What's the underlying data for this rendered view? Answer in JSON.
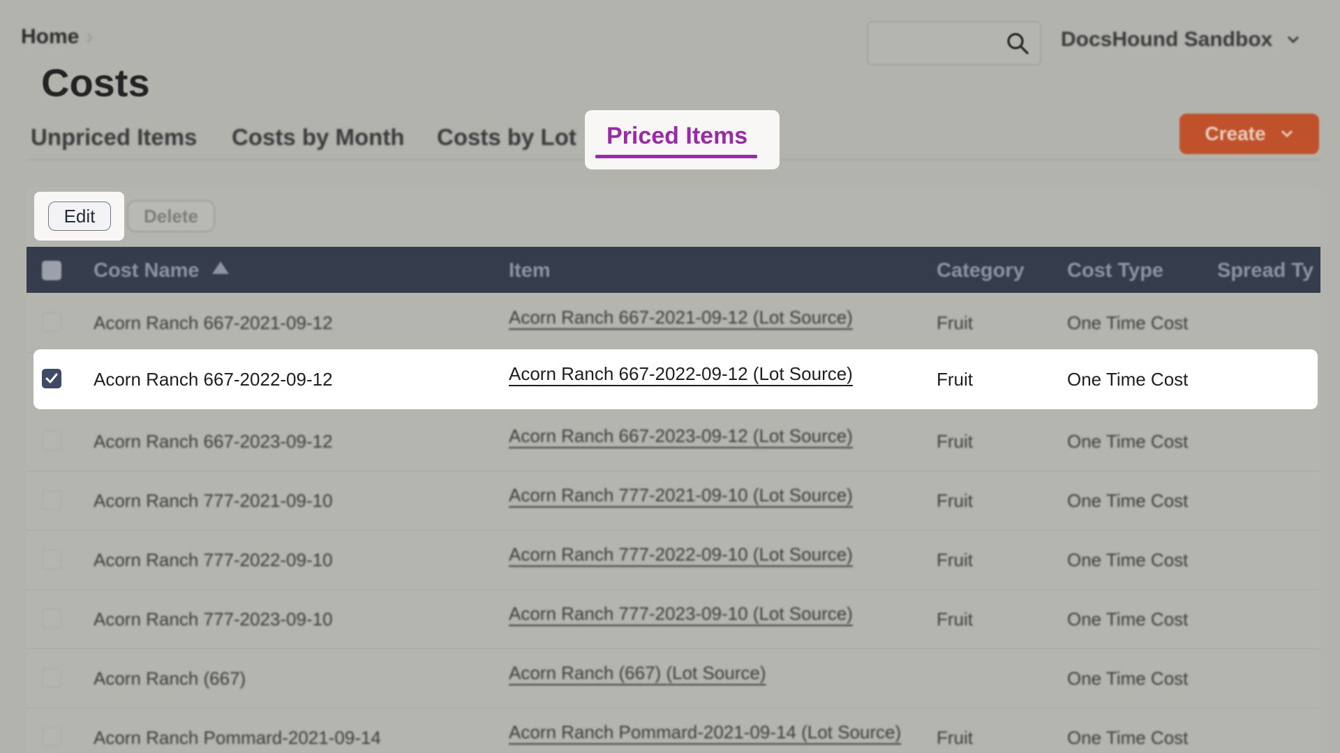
{
  "header": {
    "breadcrumb": "Home",
    "page_title": "Costs",
    "account_name": "DocsHound Sandbox",
    "create_label": "Create"
  },
  "tabs": [
    {
      "label": "Unpriced Items"
    },
    {
      "label": "Costs by Month"
    },
    {
      "label": "Costs by Lot"
    },
    {
      "label": "Priced Items",
      "active": true
    }
  ],
  "toolbar": {
    "edit_label": "Edit",
    "delete_label": "Delete"
  },
  "table": {
    "columns": [
      "Cost Name",
      "Item",
      "Category",
      "Cost Type",
      "Spread Ty"
    ],
    "sorted_column": "Cost Name",
    "rows": [
      {
        "cost_name": "Acorn Ranch 667-2021-09-12",
        "item": "Acorn Ranch 667-2021-09-12 (Lot Source)",
        "category": "Fruit",
        "cost_type": "One Time Cost",
        "selected": false
      },
      {
        "cost_name": "Acorn Ranch 667-2022-09-12",
        "item": "Acorn Ranch 667-2022-09-12 (Lot Source)",
        "category": "Fruit",
        "cost_type": "One Time Cost",
        "selected": true
      },
      {
        "cost_name": "Acorn Ranch 667-2023-09-12",
        "item": "Acorn Ranch 667-2023-09-12 (Lot Source)",
        "category": "Fruit",
        "cost_type": "One Time Cost",
        "selected": false
      },
      {
        "cost_name": "Acorn Ranch 777-2021-09-10",
        "item": "Acorn Ranch 777-2021-09-10 (Lot Source)",
        "category": "Fruit",
        "cost_type": "One Time Cost",
        "selected": false
      },
      {
        "cost_name": "Acorn Ranch 777-2022-09-10",
        "item": "Acorn Ranch 777-2022-09-10 (Lot Source)",
        "category": "Fruit",
        "cost_type": "One Time Cost",
        "selected": false
      },
      {
        "cost_name": "Acorn Ranch 777-2023-09-10",
        "item": "Acorn Ranch 777-2023-09-10 (Lot Source)",
        "category": "Fruit",
        "cost_type": "One Time Cost",
        "selected": false
      },
      {
        "cost_name": "Acorn Ranch (667)",
        "item": "Acorn Ranch (667) (Lot Source)",
        "category": "",
        "cost_type": "One Time Cost",
        "selected": false
      },
      {
        "cost_name": "Acorn Ranch Pommard-2021-09-14",
        "item": "Acorn Ranch Pommard-2021-09-14 (Lot Source)",
        "category": "Fruit",
        "cost_type": "One Time Cost",
        "selected": false
      }
    ]
  },
  "icons": {
    "search": "search-icon",
    "account_dropdown": "chevron-down-icon",
    "create_dropdown": "chevron-down-icon",
    "sort": "sort-ascending-icon",
    "check": "checkmark-icon"
  },
  "colors": {
    "accent_tab": "#9a2aa8",
    "create_button": "#c0522b",
    "table_header": "#353d4c",
    "checkbox_checked": "#3f4b66"
  }
}
